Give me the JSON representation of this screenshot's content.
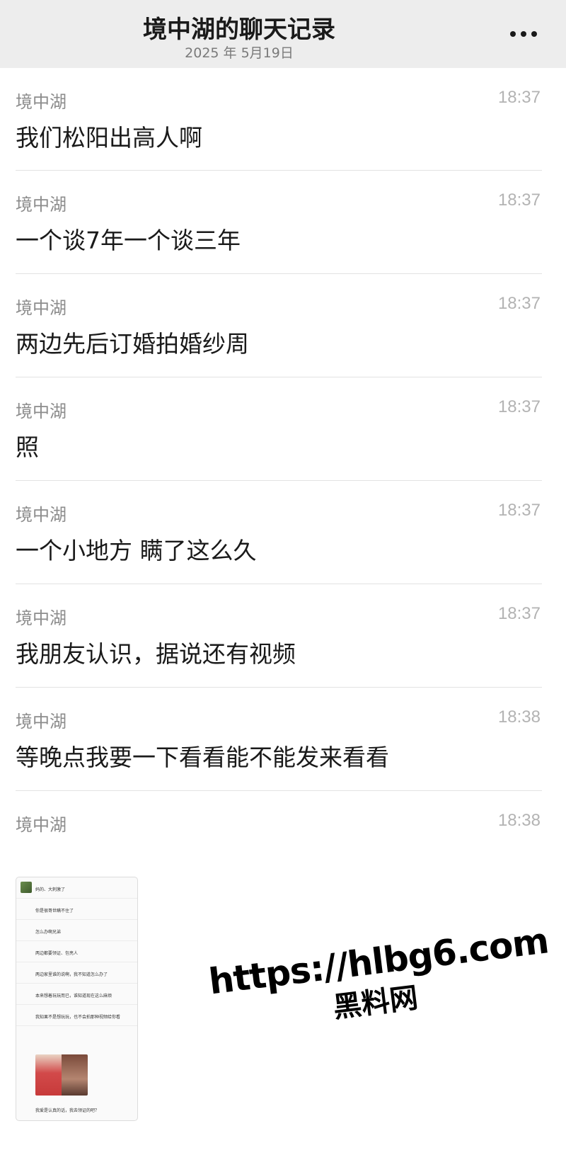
{
  "header": {
    "title": "境中湖的聊天记录",
    "date": "2025 年 5月19日",
    "more_icon": "more-dots-icon"
  },
  "messages": [
    {
      "sender": "境中湖",
      "time": "18:37",
      "text": "我们松阳出高人啊"
    },
    {
      "sender": "境中湖",
      "time": "18:37",
      "text": "一个谈7年一个谈三年"
    },
    {
      "sender": "境中湖",
      "time": "18:37",
      "text": "两边先后订婚拍婚纱周"
    },
    {
      "sender": "境中湖",
      "time": "18:37",
      "text": "照"
    },
    {
      "sender": "境中湖",
      "time": "18:37",
      "text": "一个小地方 瞒了这么久"
    },
    {
      "sender": "境中湖",
      "time": "18:37",
      "text": "我朋友认识，据说还有视频"
    },
    {
      "sender": "境中湖",
      "time": "18:38",
      "text": "等晚点我要一下看看能不能发来看看"
    }
  ],
  "image_message": {
    "sender": "境中湖",
    "time": "18:38",
    "thumbnail_lines": [
      "妈的、大刺激了",
      "你是很哥世瞒不住了",
      "怎么办啊兄弟",
      "两边都要领证、包亮人",
      "两边家里谁的说啊，我不知道怎么办了",
      "本来想着玩玩而已，谁知道现在这么麻烦",
      "我知果不是想玩玩，也不会拍那种视频给你看",
      "我爱是认真的话，我去领证的吧？"
    ]
  },
  "watermark": {
    "url": "https://hlbg6.com",
    "name": "黑料网"
  }
}
